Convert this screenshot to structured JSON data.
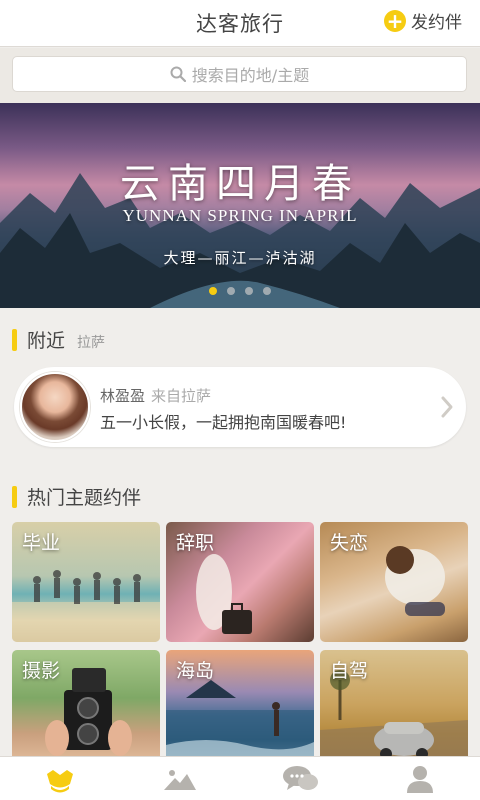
{
  "header": {
    "title": "达客旅行",
    "post_label": "发约伴",
    "post_icon": "plus-icon"
  },
  "search": {
    "placeholder": "搜索目的地/主题",
    "icon": "search-icon"
  },
  "banner": {
    "title": "云南四月春",
    "subtitle": "YUNNAN SPRING IN APRIL",
    "route": "大理—丽江—泸沽湖",
    "page_count": 4,
    "active_page": 1
  },
  "nearby": {
    "title": "附近",
    "location": "拉萨",
    "card": {
      "name": "林盈盈",
      "from": "来自拉萨",
      "message": "五一小长假，一起拥抱南国暖春吧!"
    }
  },
  "themes": {
    "title": "热门主题约伴",
    "items": [
      {
        "label": "毕业"
      },
      {
        "label": "辞职"
      },
      {
        "label": "失恋"
      },
      {
        "label": "摄影"
      },
      {
        "label": "海岛"
      },
      {
        "label": "自驾"
      }
    ]
  },
  "tabbar": {
    "items": [
      {
        "icon": "home-icon",
        "active": true
      },
      {
        "icon": "mountain-icon",
        "active": false
      },
      {
        "icon": "chat-icon",
        "active": false
      },
      {
        "icon": "profile-icon",
        "active": false
      }
    ]
  },
  "colors": {
    "accent": "#f6cc12",
    "background": "#f0eeeb",
    "inactive_icon": "#b5b2ad"
  }
}
